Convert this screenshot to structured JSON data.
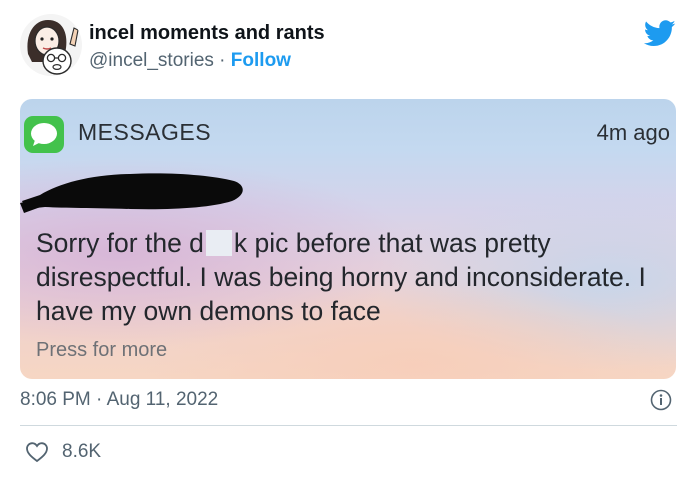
{
  "author": {
    "display_name": "incel moments and rants",
    "handle": "@incel_stories",
    "separator": " · ",
    "follow_label": "Follow",
    "avatar_icon": "cartoon-faces-avatar"
  },
  "brand": {
    "icon": "twitter-bird-icon",
    "color": "#1d9bf0"
  },
  "notification": {
    "app_icon": "messages-bubble-icon",
    "app_icon_color": "#43c24c",
    "app_name": "MESSAGES",
    "time_ago": "4m ago",
    "sender_redacted": true,
    "message_before_censor": "Sorry for the d",
    "message_after_censor": "k pic before that was pretty disrespectful. I was being horny and inconsiderate. I have my own demons to face",
    "action_hint": "Press for more"
  },
  "meta": {
    "timestamp": "8:06 PM · Aug 11, 2022",
    "like_count": "8.6K"
  }
}
